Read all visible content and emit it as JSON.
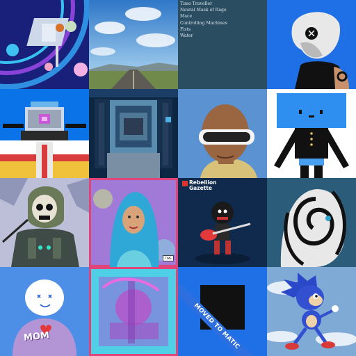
{
  "gallery": {
    "tiles": [
      {
        "name": "space-picnic-art",
        "icon": "space-picnic-image"
      },
      {
        "name": "desert-road-sky-photo",
        "icon": "landscape-image"
      },
      {
        "name": "traits-text-tile",
        "icon": "text-card",
        "traits": [
          "Time Traveller",
          "Neural Mask of Rage",
          "Mace",
          "Controlling Machines",
          "Fists",
          "Water"
        ]
      },
      {
        "name": "skull-helmet-figure",
        "icon": "skull-helmet-image"
      },
      {
        "name": "pixel-robot-knight",
        "icon": "pixel-robot-image"
      },
      {
        "name": "pixel-astronaut-portrait",
        "icon": "pixel-astronaut-image"
      },
      {
        "name": "vr-headset-avatar",
        "icon": "vr-avatar-image"
      },
      {
        "name": "box-robot-figure",
        "icon": "box-robot-image"
      },
      {
        "name": "cyber-skull-warrior",
        "icon": "cyber-skull-image"
      },
      {
        "name": "hijab-portrait-painting",
        "icon": "portrait-image",
        "signature": "TIME"
      },
      {
        "name": "rebellion-gazette-cover",
        "icon": "guitar-character-image",
        "title_line1": "Rebellion",
        "title_line2": "Gazette"
      },
      {
        "name": "swirl-face-portrait",
        "icon": "swirl-face-image"
      },
      {
        "name": "mom-hoodie-character",
        "icon": "hoodie-character-image",
        "caption": "MOM"
      },
      {
        "name": "abstract-pink-blue-collage",
        "icon": "abstract-image"
      },
      {
        "name": "moved-to-matic-card",
        "icon": "moved-card",
        "banner": "MOVED TO MATIC"
      },
      {
        "name": "running-hedgehog-cartoon",
        "icon": "hedgehog-image"
      }
    ]
  },
  "colors": {
    "blue_bg": "#1f6fe6",
    "navy": "#0b1e4a",
    "pink_border": "#e0457a"
  }
}
